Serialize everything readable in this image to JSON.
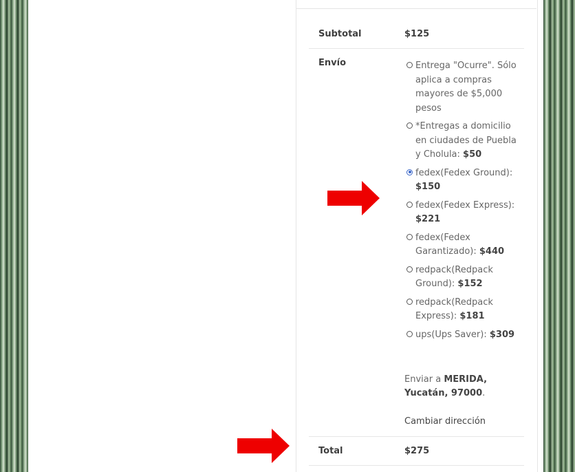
{
  "summary": {
    "subtotal_label": "Subtotal",
    "subtotal_value": "$125",
    "shipping_label": "Envío",
    "total_label": "Total",
    "total_value": "$275"
  },
  "shipping": {
    "options": [
      {
        "text": "Entrega \"Ocurre\". Sólo aplica a compras mayores de $5,000 pesos",
        "price": "",
        "selected": false
      },
      {
        "text": "*Entregas a domicilio en ciudades de Puebla y Cholula: ",
        "price": "$50",
        "selected": false
      },
      {
        "text": "fedex(Fedex Ground): ",
        "price": "$150",
        "selected": true
      },
      {
        "text": "fedex(Fedex Express): ",
        "price": "$221",
        "selected": false
      },
      {
        "text": "fedex(Fedex Garantizado): ",
        "price": "$440",
        "selected": false
      },
      {
        "text": "redpack(Redpack Ground): ",
        "price": "$152",
        "selected": false
      },
      {
        "text": "redpack(Redpack Express): ",
        "price": "$181",
        "selected": false
      },
      {
        "text": "ups(Ups Saver): ",
        "price": "$309",
        "selected": false
      }
    ],
    "ship_to_prefix": "Enviar a ",
    "ship_to_address": "MERIDA, Yucatán, 97000",
    "ship_to_suffix": ".",
    "change_address_label": "Cambiar dirección"
  },
  "colors": {
    "arrow": "#ee0000",
    "radio_selected": "#3b67c9"
  }
}
